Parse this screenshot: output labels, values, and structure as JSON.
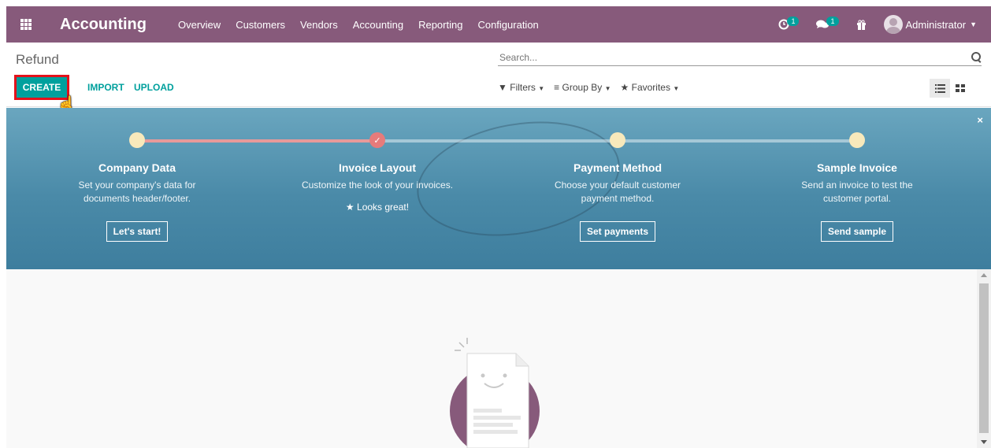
{
  "navbar": {
    "app_title": "Accounting",
    "menu": [
      "Overview",
      "Customers",
      "Vendors",
      "Accounting",
      "Reporting",
      "Configuration"
    ],
    "activity_badge": "1",
    "messages_badge": "1",
    "user": "Administrator"
  },
  "control_panel": {
    "breadcrumb": "Refund",
    "create_label": "CREATE",
    "import_label": "IMPORT",
    "upload_label": "UPLOAD",
    "search_placeholder": "Search...",
    "filters_label": "Filters",
    "group_by_label": "Group By",
    "favorites_label": "Favorites",
    "active_view": "list"
  },
  "onboarding": {
    "close_glyph": "×",
    "steps": [
      {
        "title": "Company Data",
        "desc1": "Set your company's data for",
        "desc2": "documents header/footer.",
        "button": "Let's start!"
      },
      {
        "title": "Invoice Layout",
        "desc1": "Customize the look of your invoices.",
        "desc2": "",
        "done": "Looks great!"
      },
      {
        "title": "Payment Method",
        "desc1": "Choose your default customer",
        "desc2": "payment method.",
        "button": "Set payments"
      },
      {
        "title": "Sample Invoice",
        "desc1": "Send an invoice to test the",
        "desc2": "customer portal.",
        "button": "Send sample"
      }
    ]
  },
  "colors": {
    "brand": "#875a7b",
    "accent": "#00a09d",
    "highlight": "#e3121b",
    "banner": "#4a8aa8"
  }
}
